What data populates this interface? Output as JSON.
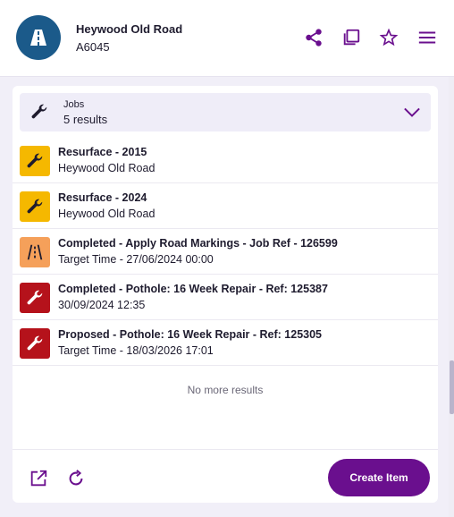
{
  "header": {
    "title": "Heywood Old Road",
    "subtitle": "A6045",
    "avatar_icon": "road-icon",
    "actions": [
      "share-icon",
      "copy-icon",
      "star-icon",
      "menu-icon"
    ]
  },
  "jobs": {
    "label": "Jobs",
    "count": "5 results",
    "icon": "wrench-icon",
    "toggle_icon": "chevron-down-icon"
  },
  "items": [
    {
      "title": "Resurface - 2015",
      "subtitle": "Heywood Old Road",
      "icon": "wrench-icon",
      "color": "#f5b800"
    },
    {
      "title": "Resurface - 2024",
      "subtitle": "Heywood Old Road",
      "icon": "wrench-icon",
      "color": "#f5b800"
    },
    {
      "title": "Completed - Apply Road Markings - Job Ref - 126599",
      "subtitle": "Target Time - 27/06/2024 00:00",
      "icon": "road-markings-icon",
      "color": "#f5a05a"
    },
    {
      "title": "Completed - Pothole: 16 Week Repair - Ref: 125387",
      "subtitle": "30/09/2024 12:35",
      "icon": "wrench-icon",
      "color": "#b5121b"
    },
    {
      "title": "Proposed - Pothole: 16 Week Repair - Ref: 125305",
      "subtitle": "Target Time - 18/03/2026 17:01",
      "icon": "wrench-icon",
      "color": "#b5121b"
    }
  ],
  "no_more": "No more results",
  "footer": {
    "create_label": "Create Item",
    "actions": [
      "open-external-icon",
      "refresh-icon"
    ]
  },
  "colors": {
    "accent": "#6a0f8e",
    "avatar": "#1b5a8a"
  }
}
